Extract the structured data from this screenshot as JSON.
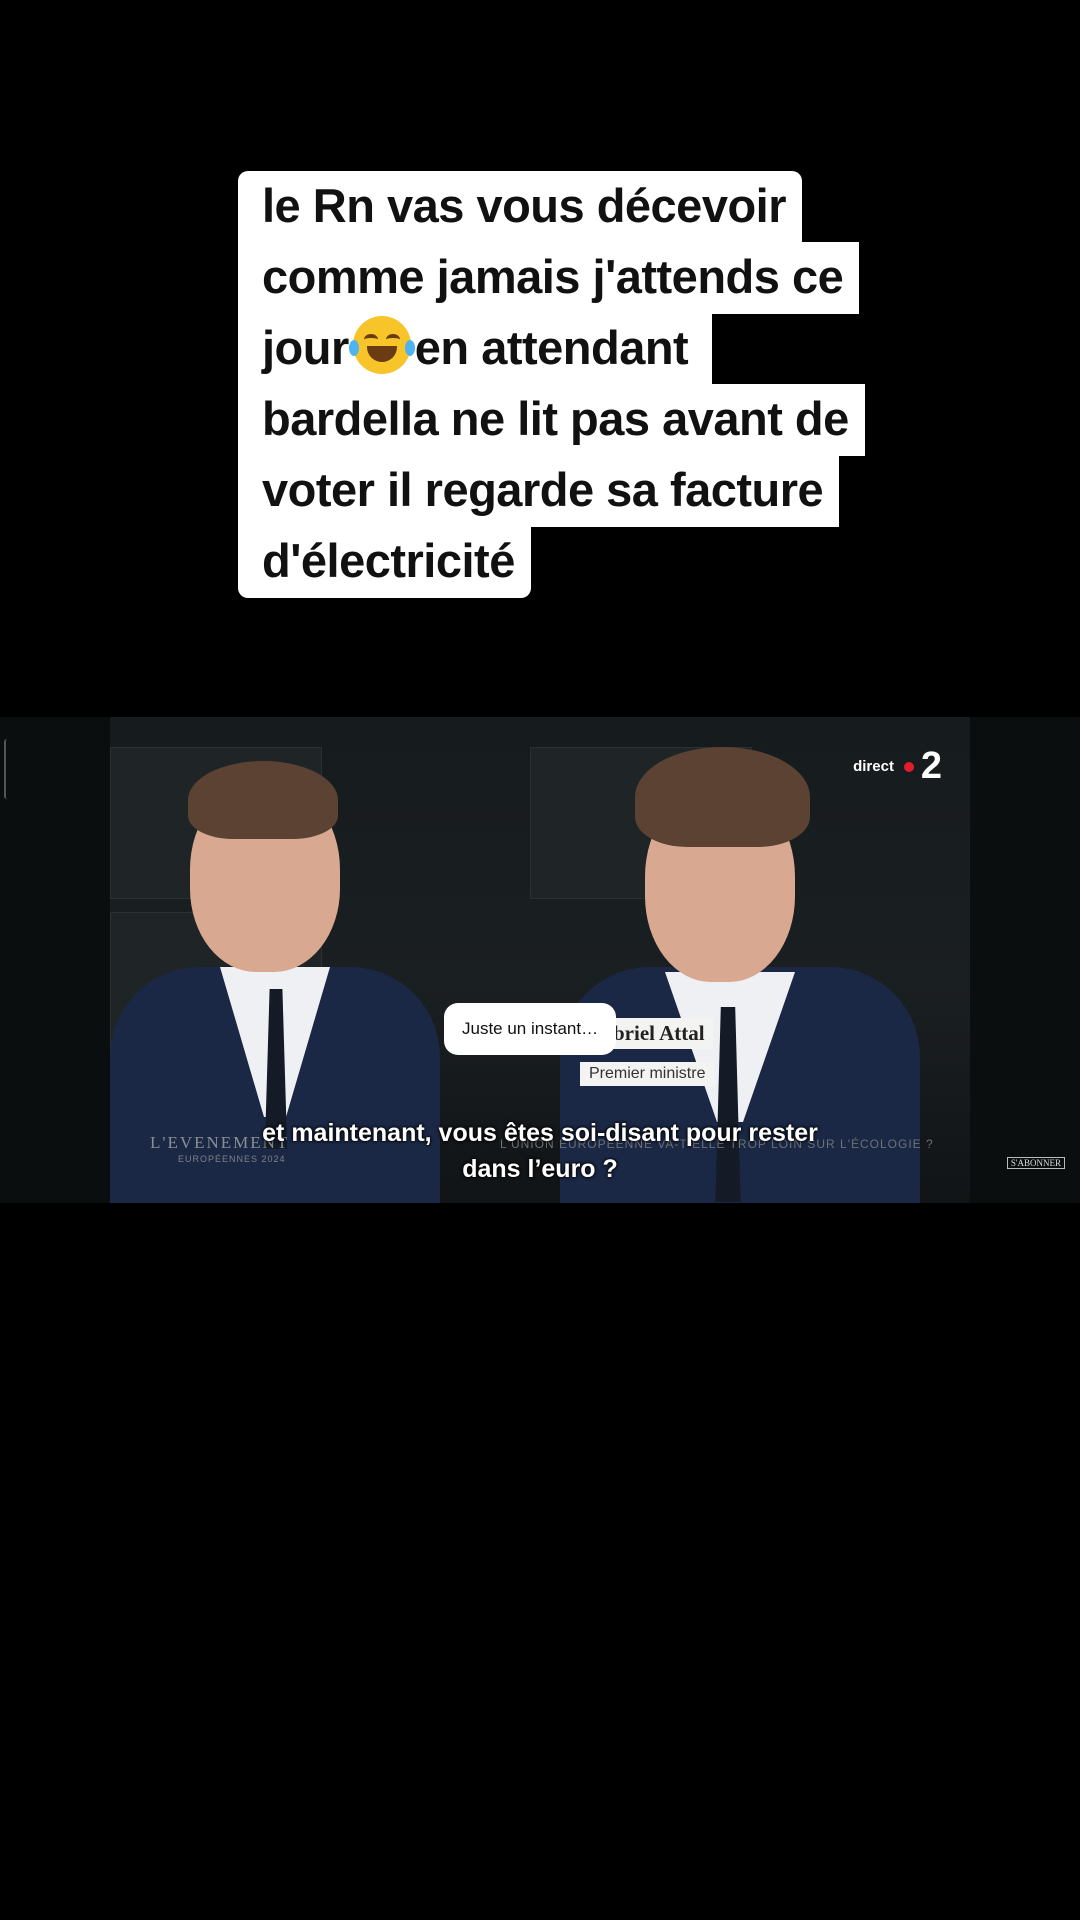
{
  "caption": {
    "lines": [
      "le Rn vas vous décevoir",
      "comme jamais j'attends ce",
      "jour",
      "en attendant",
      "bardella ne lit pas avant de",
      "voter il regarde sa facture",
      "d'électricité"
    ],
    "emoji": "face-with-tears-of-joy"
  },
  "video": {
    "channel_logo_text": "direct",
    "channel_number": "2",
    "tooltip": "Juste un instant…",
    "name_label": "briel Attal",
    "role_label": "Premier ministre",
    "show_title": "L'EVENEMENT",
    "show_subtitle": "EUROPÉENNES 2024",
    "topic": "L'UNION EUROPÉENNE VA-T-ELLE TROP LOIN SUR L'ÉCOLOGIE ?",
    "subtitle_line1": "et maintenant, vous êtes soi-disant pour rester",
    "subtitle_line2": "dans l’euro ?",
    "subscribe_badge": "S'ABONNER"
  }
}
